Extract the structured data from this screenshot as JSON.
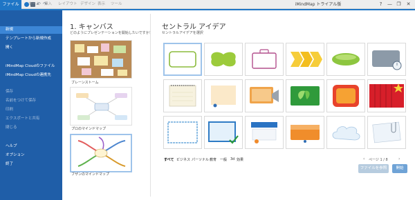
{
  "titlebar": {
    "file_tab": "ファイル",
    "ribbon_tabs": [
      "ホーム",
      "挿入",
      "レイアウト",
      "デザイン",
      "表示",
      "ツール"
    ],
    "app_title": "iMindMap トライアル版",
    "window_buttons": [
      "?",
      "—",
      "❐",
      "✕"
    ]
  },
  "sidebar": {
    "items": [
      {
        "label": "新規"
      },
      {
        "label": "テンプレートから新規作成"
      },
      {
        "label": "開く"
      },
      {
        "label": "iMindMap Cloudのファイル"
      },
      {
        "label": "iMindMap Cloudの連携先"
      },
      {
        "label": "保存"
      },
      {
        "label": "名前をつけて保存"
      },
      {
        "label": "印刷"
      },
      {
        "label": "エクスポートと共有"
      },
      {
        "label": "閉じる"
      },
      {
        "label": "ヘルプ"
      },
      {
        "label": "オプション"
      },
      {
        "label": "終了"
      }
    ]
  },
  "canvas": {
    "title": "1. キャンバス",
    "subtitle": "どのようにプレゼンテーションを開始したいですか？",
    "options": [
      {
        "label": "ブレーンストーム"
      },
      {
        "label": "プロのマインドマップ"
      },
      {
        "label": "ブザンのマインドマップ"
      }
    ]
  },
  "central_idea": {
    "title": "セントラル アイデア",
    "subtitle": "セントラルアイデアを選択",
    "filters": [
      "すべて",
      "ビジネス",
      "パーソナル",
      "教育",
      "一般",
      "3d",
      "効果"
    ],
    "pager": "ページ 1 / 8",
    "open_file_button": "ファイルを参照",
    "start_button": "開始"
  },
  "colors": {
    "accent": "#1f76c6",
    "sidebar_bg": "#1f5ea8",
    "sidebar_active": "#3c86d6"
  }
}
